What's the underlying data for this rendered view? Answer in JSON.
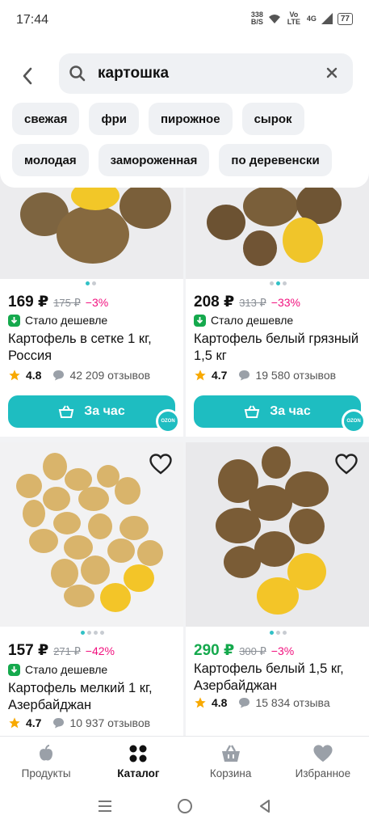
{
  "status": {
    "time": "17:44",
    "speed_value": "338",
    "speed_unit": "B/S",
    "network": "Vo LTE",
    "signal": "4G",
    "battery": "77"
  },
  "search": {
    "query": "картошка"
  },
  "chips_row1": [
    "свежая",
    "фри",
    "пирожное",
    "сырок"
  ],
  "chips_row2": [
    "молодая",
    "замороженная",
    "по деревенски"
  ],
  "products": [
    {
      "price": "169 ₽",
      "old_price": "175 ₽",
      "discount": "−3%",
      "cheaper": "Стало дешевле",
      "title": "Картофель в сетке 1 кг, Россия",
      "rating": "4.8",
      "reviews": "42 209 отзывов",
      "button": "За час",
      "badge": "OZON"
    },
    {
      "price": "208 ₽",
      "old_price": "313 ₽",
      "discount": "−33%",
      "cheaper": "Стало дешевле",
      "title": "Картофель белый грязный 1,5 кг",
      "rating": "4.7",
      "reviews": "19 580 отзывов",
      "button": "За час",
      "badge": "OZON"
    },
    {
      "price": "157 ₽",
      "old_price": "271 ₽",
      "discount": "−42%",
      "cheaper": "Стало дешевле",
      "title": "Картофель мелкий 1 кг, Азербайджан",
      "rating": "4.7",
      "reviews": "10 937 отзывов"
    },
    {
      "price": "290 ₽",
      "old_price": "300 ₽",
      "discount": "−3%",
      "title": "Картофель белый 1,5 кг, Азербайджан",
      "rating": "4.8",
      "reviews": "15 834 отзыва"
    }
  ],
  "nav": [
    {
      "label": "Продукты",
      "icon": "apple-icon"
    },
    {
      "label": "Каталог",
      "icon": "grid-icon"
    },
    {
      "label": "Корзина",
      "icon": "basket-icon"
    },
    {
      "label": "Избранное",
      "icon": "heart-icon"
    }
  ],
  "colors": {
    "accent": "#1ebdc1",
    "discount": "#f1117e",
    "green": "#15a94d"
  }
}
